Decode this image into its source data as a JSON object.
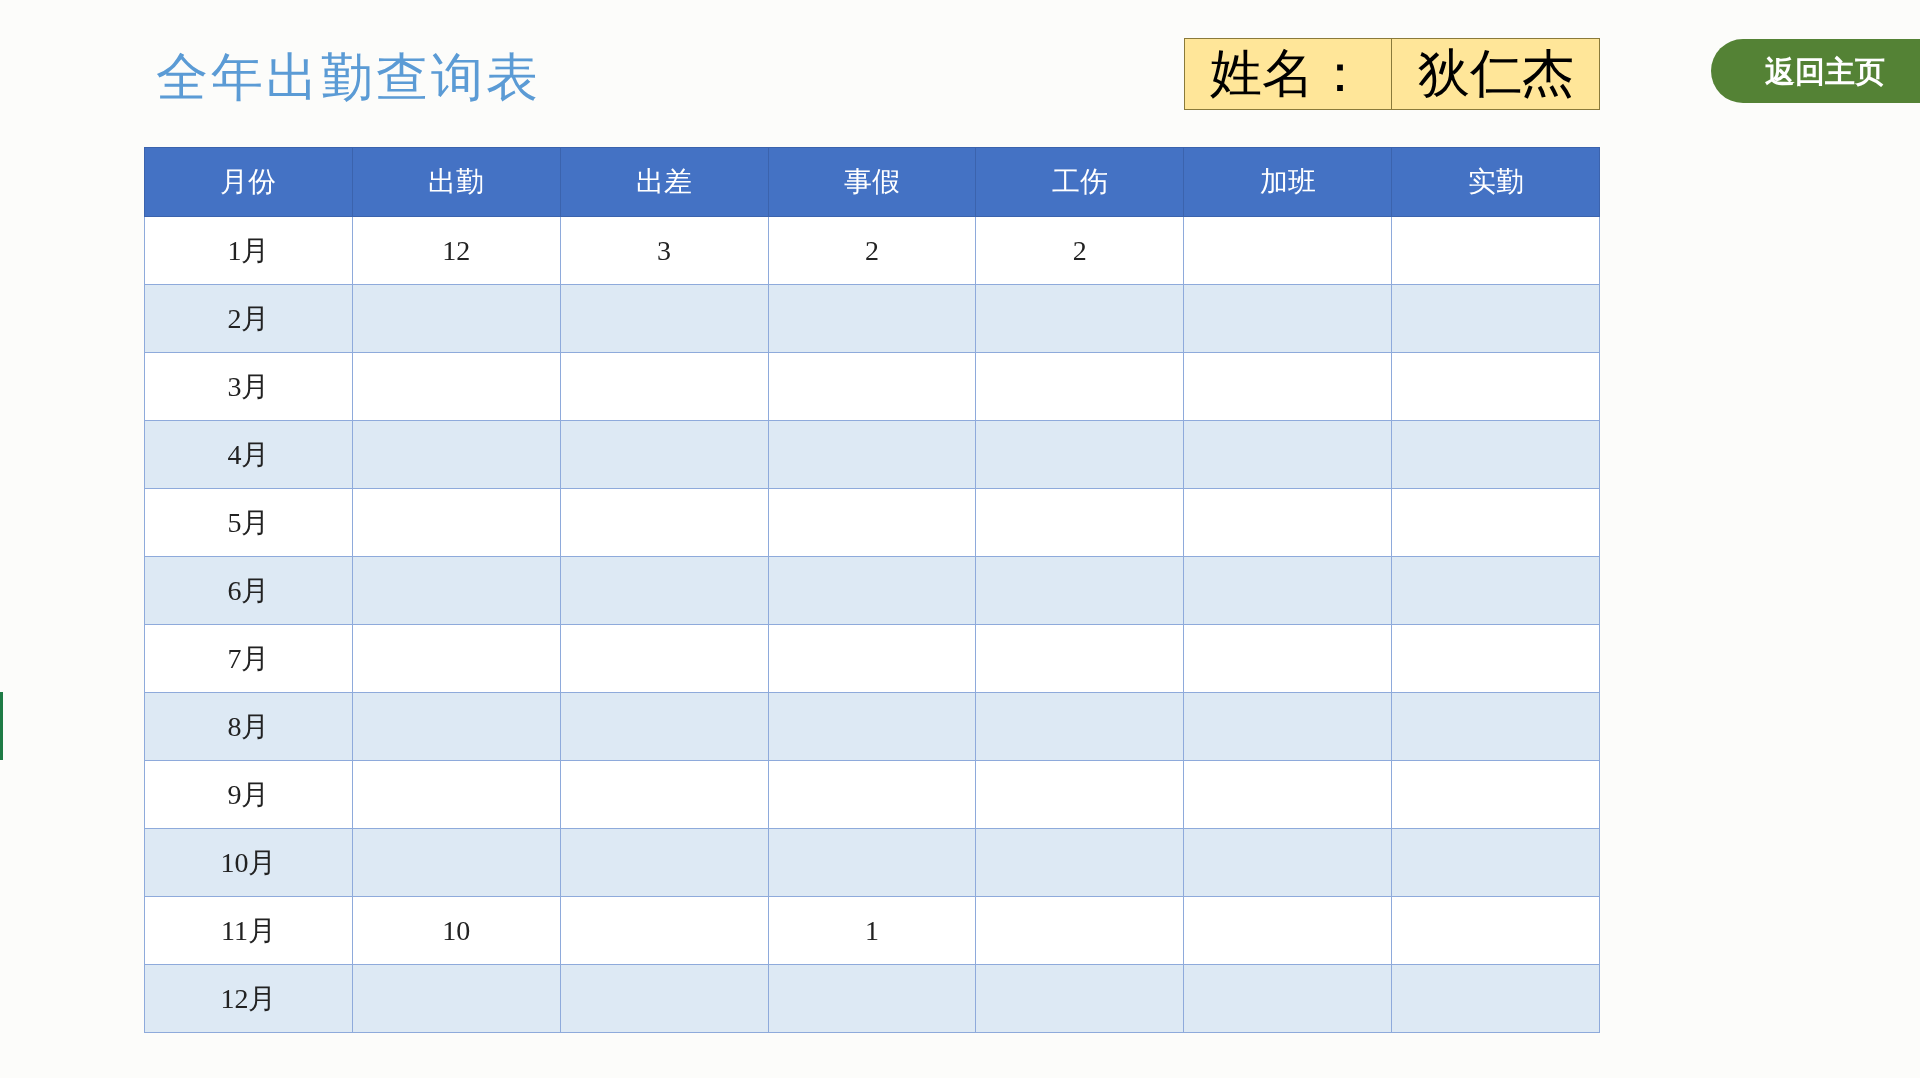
{
  "title": "全年出勤查询表",
  "name_field": {
    "label": "姓名：",
    "value": "狄仁杰"
  },
  "home_button": "返回主页",
  "table": {
    "columns": [
      "月份",
      "出勤",
      "出差",
      "事假",
      "工伤",
      "加班",
      "实勤"
    ],
    "rows": [
      {
        "cells": [
          {
            "text": "1月"
          },
          {
            "text": "12"
          },
          {
            "text": "3"
          },
          {
            "text": "2"
          },
          {
            "text": "2"
          }
        ]
      },
      {
        "cells": [
          {
            "text": "2月"
          }
        ]
      },
      {
        "cells": [
          {
            "text": "3月"
          }
        ]
      },
      {
        "cells": [
          {
            "text": "4月"
          }
        ]
      },
      {
        "cells": [
          {
            "text": "5月"
          }
        ]
      },
      {
        "cells": [
          {
            "text": "6月"
          }
        ]
      },
      {
        "cells": [
          {
            "text": "7月"
          }
        ]
      },
      {
        "cells": [
          {
            "text": "8月"
          }
        ]
      },
      {
        "cells": [
          {
            "text": "9月"
          }
        ]
      },
      {
        "cells": [
          {
            "text": "10月"
          }
        ]
      },
      {
        "cells": [
          {
            "text": "11月"
          },
          {
            "text": "10"
          },
          {},
          {
            "text": "1"
          }
        ]
      },
      {
        "cells": [
          {
            "text": "12月"
          }
        ]
      }
    ]
  }
}
